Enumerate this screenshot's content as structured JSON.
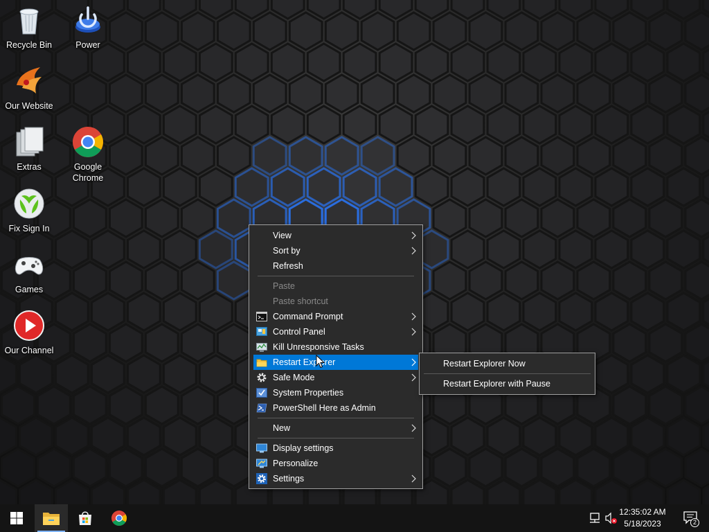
{
  "desktop": {
    "icons": [
      {
        "label": "Recycle Bin",
        "icon": "recycle-bin-icon"
      },
      {
        "label": "Power",
        "icon": "power-icon"
      },
      {
        "label": "Our Website",
        "icon": "website-phoenix-icon"
      },
      {
        "label": "Extras",
        "icon": "folders-icon"
      },
      {
        "label": "Google Chrome",
        "icon": "chrome-icon"
      },
      {
        "label": "Fix Sign In",
        "icon": "xbox-icon"
      },
      {
        "label": "Games",
        "icon": "gamepad-icon"
      },
      {
        "label": "Our Channel",
        "icon": "play-button-icon"
      }
    ]
  },
  "context_menu": {
    "items": [
      {
        "label": "View",
        "submenu": true
      },
      {
        "label": "Sort by",
        "submenu": true
      },
      {
        "label": "Refresh"
      },
      {
        "label": "Paste",
        "disabled": true
      },
      {
        "label": "Paste shortcut",
        "disabled": true
      },
      {
        "label": "Command Prompt",
        "submenu": true,
        "icon": "command-prompt-icon"
      },
      {
        "label": "Control Panel",
        "submenu": true,
        "icon": "control-panel-icon"
      },
      {
        "label": "Kill Unresponsive Tasks",
        "icon": "task-monitor-icon"
      },
      {
        "label": "Restart Explorer",
        "submenu": true,
        "icon": "file-explorer-icon",
        "highlighted": true
      },
      {
        "label": "Safe Mode",
        "submenu": true,
        "icon": "gear-icon"
      },
      {
        "label": "System Properties",
        "icon": "system-properties-icon"
      },
      {
        "label": "PowerShell Here as Admin",
        "icon": "powershell-icon"
      },
      {
        "label": "New",
        "submenu": true
      },
      {
        "label": "Display settings",
        "icon": "display-icon"
      },
      {
        "label": "Personalize",
        "icon": "personalize-icon"
      },
      {
        "label": "Settings",
        "submenu": true,
        "icon": "settings-gear-icon"
      }
    ]
  },
  "submenu": {
    "items": [
      {
        "label": "Restart Explorer Now"
      },
      {
        "label": "Restart Explorer with Pause"
      }
    ]
  },
  "taskbar": {
    "apps": [
      "start-icon",
      "file-explorer-icon",
      "store-icon",
      "chrome-icon"
    ],
    "active_app": "file-explorer-icon",
    "clock": {
      "time": "12:35:02 AM",
      "date": "5/18/2023"
    },
    "notifications": "2"
  },
  "colors": {
    "accent": "#0078d7",
    "menu_bg": "#2b2b2b",
    "taskbar_bg": "#141414"
  }
}
